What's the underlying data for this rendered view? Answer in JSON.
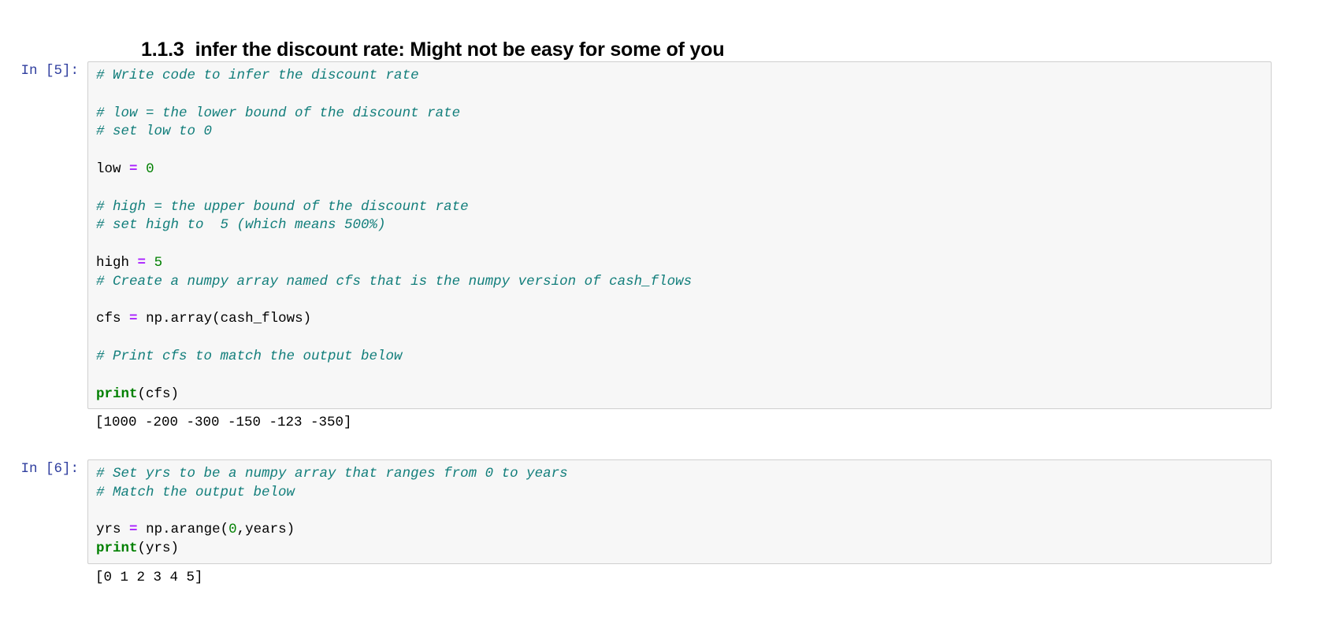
{
  "heading": {
    "section_number": "1.1.3",
    "text": "infer the discount rate: Might not be easy for some of you"
  },
  "cells": [
    {
      "prompt": "In [5]:",
      "code_lines": [
        {
          "text": "# Write code to infer the discount rate",
          "type": "comment"
        },
        {
          "text": "",
          "type": "blank"
        },
        {
          "text": "# low = the lower bound of the discount rate",
          "type": "comment"
        },
        {
          "text": "# set low to 0",
          "type": "comment"
        },
        {
          "text": "",
          "type": "blank"
        },
        {
          "text": "low = 0",
          "type": "code"
        },
        {
          "text": "",
          "type": "blank"
        },
        {
          "text": "# high = the upper bound of the discount rate",
          "type": "comment"
        },
        {
          "text": "# set high to  5 (which means 500%)",
          "type": "comment"
        },
        {
          "text": "",
          "type": "blank"
        },
        {
          "text": "high = 5",
          "type": "code"
        },
        {
          "text": "# Create a numpy array named cfs that is the numpy version of cash_flows",
          "type": "comment"
        },
        {
          "text": "",
          "type": "blank"
        },
        {
          "text": "cfs = np.array(cash_flows)",
          "type": "code"
        },
        {
          "text": "",
          "type": "blank"
        },
        {
          "text": "# Print cfs to match the output below",
          "type": "comment"
        },
        {
          "text": "",
          "type": "blank"
        },
        {
          "text": "print(cfs)",
          "type": "code"
        }
      ],
      "output": "[1000 -200 -300 -150 -123 -350]"
    },
    {
      "prompt": "In [6]:",
      "code_lines": [
        {
          "text": "# Set yrs to be a numpy array that ranges from 0 to years",
          "type": "comment"
        },
        {
          "text": "# Match the output below",
          "type": "comment"
        },
        {
          "text": "",
          "type": "blank"
        },
        {
          "text": "yrs = np.arange(0,years)",
          "type": "code"
        },
        {
          "text": "print(yrs)",
          "type": "code"
        }
      ],
      "output": "[0 1 2 3 4 5]"
    }
  ],
  "colors": {
    "comment": "#127e7b",
    "operator": "#aa22ff",
    "number": "#008000",
    "builtin": "#008000",
    "prompt": "#303f9f",
    "cell_background": "#f7f7f7",
    "cell_border": "#cfcfcf",
    "page_background": "#ffffff",
    "text": "#000000"
  }
}
